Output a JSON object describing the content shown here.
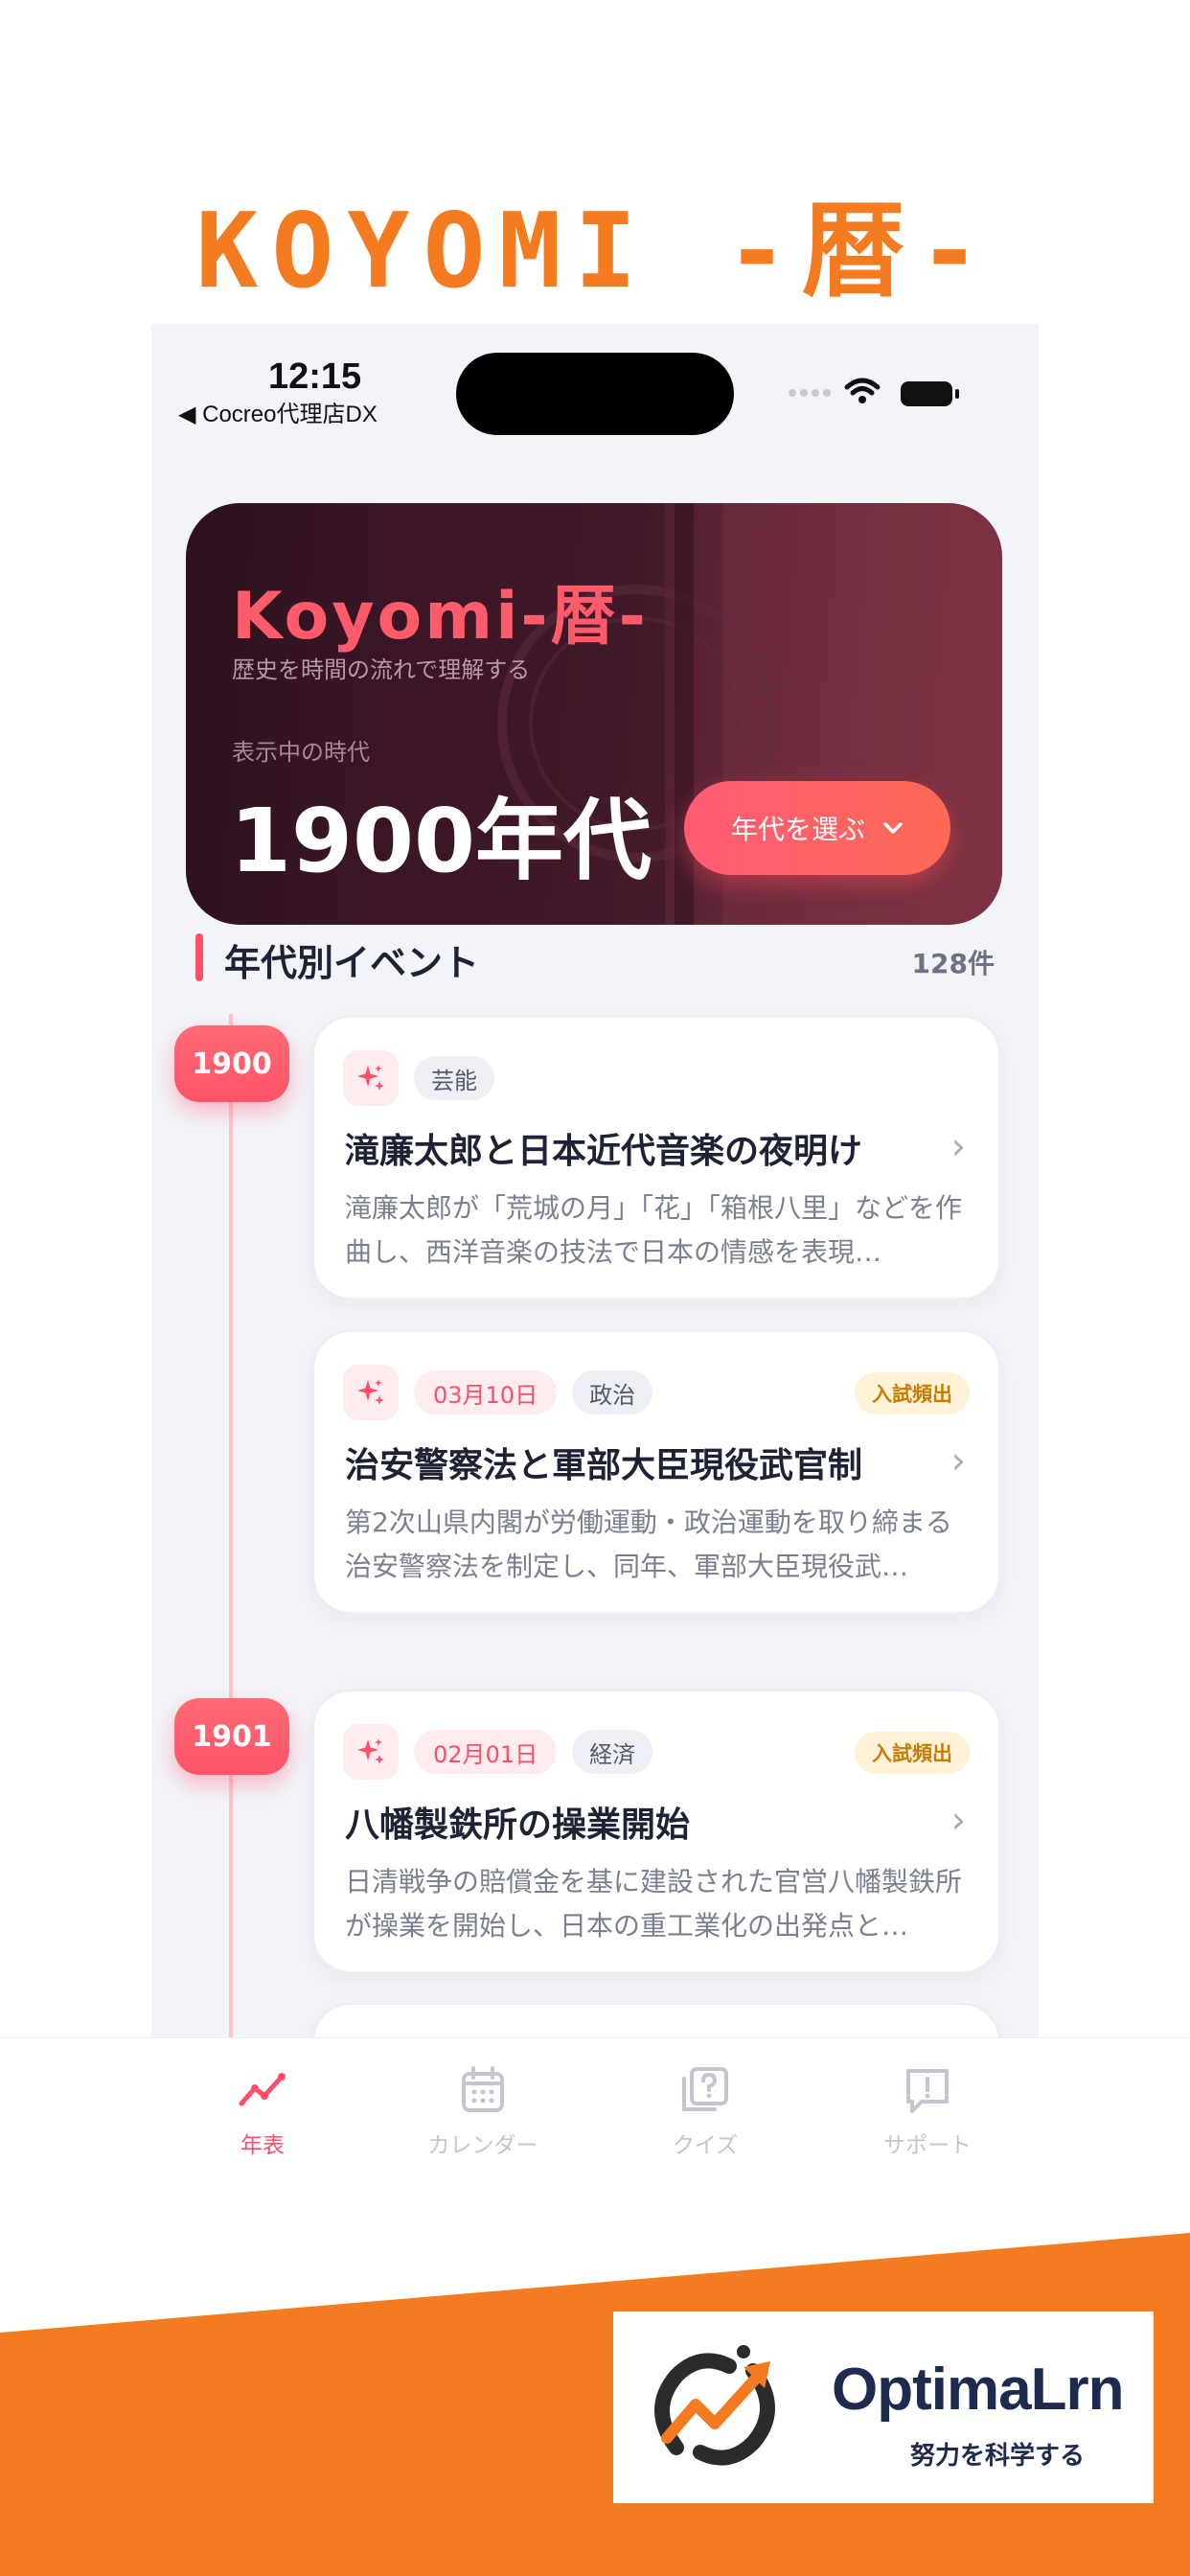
{
  "promo": {
    "title": "KOYOMI -暦-"
  },
  "status_bar": {
    "time": "12:15",
    "carrier": "◀ Cocreo代理店DX"
  },
  "hero": {
    "title": "Koyomi-暦-",
    "subtitle": "歴史を時間の流れで理解する",
    "label": "表示中の時代",
    "era": "1900年代",
    "button_label": "年代を選ぶ",
    "button_icon": "chevron-down-icon"
  },
  "section": {
    "title": "年代別イベント",
    "count": "128件"
  },
  "timeline": [
    {
      "year": "1900",
      "events": [
        {
          "date": "",
          "category": "芸能",
          "exam": "",
          "title": "滝廉太郎と日本近代音楽の夜明け",
          "description": "滝廉太郎が「荒城の月」「花」「箱根八里」などを作曲し、西洋音楽の技法で日本の情感を表現…"
        },
        {
          "date": "03月10日",
          "category": "政治",
          "exam": "入試頻出",
          "title": "治安警察法と軍部大臣現役武官制",
          "description": "第2次山県内閣が労働運動・政治運動を取り締まる治安警察法を制定し、同年、軍部大臣現役武…"
        }
      ]
    },
    {
      "year": "1901",
      "events": [
        {
          "date": "02月01日",
          "category": "経済",
          "exam": "入試頻出",
          "title": "八幡製鉄所の操業開始",
          "description": "日清戦争の賠償金を基に建設された官営八幡製鉄所が操業を開始し、日本の重工業化の出発点と…"
        }
      ]
    }
  ],
  "tabs": [
    {
      "label": "年表",
      "icon": "chart-line-icon",
      "active": true
    },
    {
      "label": "カレンダー",
      "icon": "calendar-icon",
      "active": false
    },
    {
      "label": "クイズ",
      "icon": "quiz-icon",
      "active": false
    },
    {
      "label": "サポート",
      "icon": "support-icon",
      "active": false
    }
  ],
  "footer": {
    "brand": "OptimaLrn",
    "tagline": "努力を科学する"
  },
  "colors": {
    "accent": "#ff4d6a",
    "brand_orange": "#f47b20",
    "navy": "#1f2a4f"
  }
}
